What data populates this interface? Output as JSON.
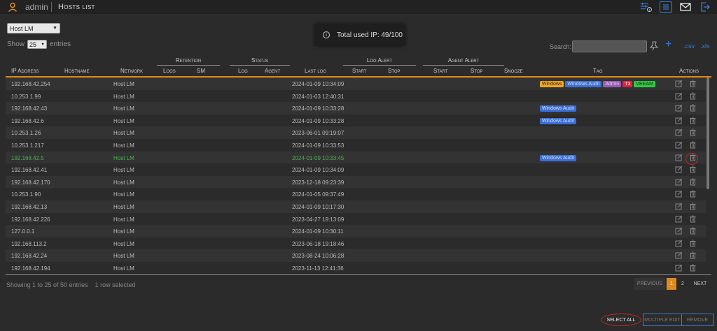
{
  "topbar": {
    "username": "admin",
    "title": "Hosts list",
    "icons": [
      "sliders-info-icon",
      "list-icon",
      "mail-icon",
      "logout-icon"
    ]
  },
  "host_select": {
    "value": "Host LM"
  },
  "length": {
    "show": "Show",
    "value": "25",
    "entries": "entries"
  },
  "toast": {
    "text": "Total used IP: 49/100"
  },
  "search": {
    "label": "Search:",
    "placeholder": ""
  },
  "exports": {
    "csv": ".csv",
    "xls": ".xls"
  },
  "groups": {
    "retention": "Retention",
    "status": "Status",
    "log_alert": "Log Alert",
    "agent_alert": "Agent Alert"
  },
  "columns": {
    "ip": "IP Address",
    "hostname": "Hostname",
    "network": "Network",
    "logs": "Logs",
    "sm": "SM",
    "log": "Log",
    "agent": "Agent",
    "last_log": "Last log",
    "la_start": "Start",
    "la_stop": "Stop",
    "aa_start": "Start",
    "aa_stop": "Stop",
    "snooze": "Snooze",
    "tag": "Tag",
    "actions": "Actions"
  },
  "rows": [
    {
      "ip": "192.168.42.254",
      "network": "Host LM",
      "last_log": "2024-01-09 10:34:09",
      "tags": [
        "Windows",
        "Windows Audit",
        "Admin",
        "T3",
        "VEEAM"
      ]
    },
    {
      "ip": "10.253.1.99",
      "network": "Host LM",
      "last_log": "2024-01-03 12:40:31",
      "tags": []
    },
    {
      "ip": "192.168.42.43",
      "network": "Host LM",
      "last_log": "2024-01-09 10:33:28",
      "tags": [
        "Windows Audit"
      ]
    },
    {
      "ip": "192.168.42.6",
      "network": "Host LM",
      "last_log": "2024-01-09 10:33:28",
      "tags": [
        "Windows Audit"
      ]
    },
    {
      "ip": "10.253.1.26",
      "network": "Host LM",
      "last_log": "2023-06-01 09:19:07",
      "tags": []
    },
    {
      "ip": "10.253.1.217",
      "network": "Host LM",
      "last_log": "2024-01-09 10:33:53",
      "tags": []
    },
    {
      "ip": "192.168.42.5",
      "network": "Host LM",
      "last_log": "2024-01-09 10:33:45",
      "tags": [
        "Windows Audit"
      ],
      "selected": true
    },
    {
      "ip": "192.168.42.41",
      "network": "Host LM",
      "last_log": "2024-01-09 10:34:09",
      "tags": []
    },
    {
      "ip": "192.168.42.170",
      "network": "Host LM",
      "last_log": "2023-12-18 09:23:39",
      "tags": []
    },
    {
      "ip": "10.253.1.90",
      "network": "Host LM",
      "last_log": "2024-01-05 09:37:49",
      "tags": []
    },
    {
      "ip": "192.168.42.13",
      "network": "Host LM",
      "last_log": "2024-01-09 10:17:30",
      "tags": []
    },
    {
      "ip": "192.168.42.226",
      "network": "Host LM",
      "last_log": "2023-04-27 19:13:09",
      "tags": []
    },
    {
      "ip": "127.0.0.1",
      "network": "Host LM",
      "last_log": "2024-01-09 10:30:11",
      "tags": []
    },
    {
      "ip": "192.168.113.2",
      "network": "Host LM",
      "last_log": "2023-06-18 19:18:46",
      "tags": []
    },
    {
      "ip": "192.168.42.24",
      "network": "Host LM",
      "last_log": "2023-08-24 10:06:28",
      "tags": []
    },
    {
      "ip": "192.168.42.194",
      "network": "Host LM",
      "last_log": "2023-11-13 12:41:36",
      "tags": []
    }
  ],
  "tag_colors": {
    "Windows": "#f5a623",
    "Windows Audit": "#3a6fd8",
    "Admin": "#9b59b6",
    "T3": "#e0223a",
    "VEEAM": "#2ecc40"
  },
  "footer": {
    "info": "Showing 1 to 25 of 50 entries",
    "selected": "1 row selected",
    "previous": "PREVIOUS",
    "page1": "1",
    "page2": "2",
    "next": "NEXT"
  },
  "actions": {
    "select_all": "SELECT ALL",
    "multiple_edit": "MULTIPLE EDIT",
    "remove": "REMOVE"
  }
}
